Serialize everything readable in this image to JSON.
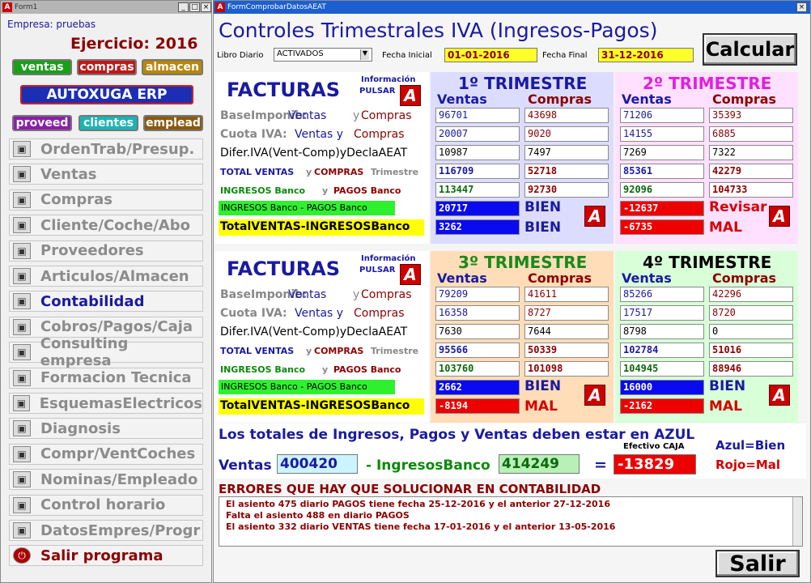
{
  "left_window": {
    "title": "Form1",
    "company": "Empresa: pruebas",
    "ejercicio": "Ejercicio: 2016",
    "tabs": [
      "ventas",
      "compras",
      "almacen"
    ],
    "banner": "AUTOXUGA ERP",
    "tabs2": [
      "proveed",
      "clientes",
      "emplead"
    ],
    "menu": [
      {
        "label": "OrdenTrab/Presup.",
        "icon": "tools-icon"
      },
      {
        "label": "Ventas",
        "icon": "sales-chart-icon"
      },
      {
        "label": "Compras",
        "icon": "purchases-icon"
      },
      {
        "label": "Cliente/Coche/Abo",
        "icon": "clients-icon"
      },
      {
        "label": "Proveedores",
        "icon": "suppliers-icon"
      },
      {
        "label": "Articulos/Almacen",
        "icon": "warehouse-icon"
      },
      {
        "label": "Contabilidad",
        "icon": "accounting-chart-icon"
      },
      {
        "label": "Cobros/Pagos/Caja",
        "icon": "cash-icon"
      },
      {
        "label": "Consulting empresa",
        "icon": "consulting-icon"
      },
      {
        "label": "Formacion Tecnica",
        "icon": "training-icon"
      },
      {
        "label": "EsquemasElectricos",
        "icon": "schematics-icon"
      },
      {
        "label": "Diagnosis",
        "icon": "diagnosis-icon"
      },
      {
        "label": "Compr/VentCoches",
        "icon": "car-icon"
      },
      {
        "label": "Nominas/Empleado",
        "icon": "employees-icon"
      },
      {
        "label": "Control horario",
        "icon": "clock-icon"
      },
      {
        "label": "DatosEmpres/Progr",
        "icon": "gear-icon"
      },
      {
        "label": "Salir programa",
        "icon": "exit-icon"
      }
    ]
  },
  "right_window": {
    "title": "FormComprobarDatosAEAT",
    "heading": "Controles Trimestrales IVA (Ingresos-Pagos)",
    "libro_label": "Libro Diario",
    "libro_value": "ACTIVADOS",
    "fecha_inicial_label": "Fecha Inicial",
    "fecha_inicial": "01-01-2016",
    "fecha_final_label": "Fecha Final",
    "fecha_final": "31-12-2016",
    "calcular": "Calcular",
    "facturas": "FACTURAS",
    "info": "Información",
    "pulsar": "PULSAR",
    "row_labels": {
      "base_a": "BaseImponib:",
      "base_b": "Ventas",
      "base_y": "y",
      "base_c": "Compras",
      "cuota_a": "Cuota IVA:",
      "cuota_b": "Ventas y",
      "cuota_c": "Compras",
      "difer": "Difer.IVA(Vent-Comp)yDeclaAEAT",
      "total_a": "TOTAL VENTAS",
      "total_y": "y",
      "total_b": "COMPRAS",
      "total_c": "Trimestre",
      "ing_a": "INGRESOS Banco",
      "ing_y": "y",
      "ing_b": "PAGOS Banco",
      "ingpag": "INGRESOS Banco - PAGOS Banco",
      "totalvi": "TotalVENTAS-INGRESOSBanco"
    },
    "ventas": "Ventas",
    "compras": "Compras",
    "trimestres": [
      {
        "title": "1º TRIMESTRE",
        "base": [
          "96701",
          "43698"
        ],
        "cuota": [
          "20007",
          "9020"
        ],
        "difer": [
          "10987",
          "7497"
        ],
        "total": [
          "116709",
          "52718"
        ],
        "banco": [
          "113447",
          "92730"
        ],
        "ip": "20717",
        "ip_status": "BIEN",
        "tv": "3262",
        "tv_status": "BIEN"
      },
      {
        "title": "2º TRIMESTRE",
        "base": [
          "71206",
          "35393"
        ],
        "cuota": [
          "14155",
          "6885"
        ],
        "difer": [
          "7269",
          "7322"
        ],
        "total": [
          "85361",
          "42279"
        ],
        "banco": [
          "92096",
          "104733"
        ],
        "ip": "-12637",
        "ip_status": "Revisar",
        "tv": "-6735",
        "tv_status": "MAL"
      },
      {
        "title": "3º TRIMESTRE",
        "base": [
          "79209",
          "41611"
        ],
        "cuota": [
          "16358",
          "8727"
        ],
        "difer": [
          "7630",
          "7644"
        ],
        "total": [
          "95566",
          "50339"
        ],
        "banco": [
          "103760",
          "101098"
        ],
        "ip": "2662",
        "ip_status": "BIEN",
        "tv": "-8194",
        "tv_status": "MAL"
      },
      {
        "title": "4º TRIMESTRE",
        "base": [
          "85266",
          "42296"
        ],
        "cuota": [
          "17517",
          "8720"
        ],
        "difer": [
          "8798",
          "0"
        ],
        "total": [
          "102784",
          "51016"
        ],
        "banco": [
          "104945",
          "88946"
        ],
        "ip": "16000",
        "ip_status": "BIEN",
        "tv": "-2162",
        "tv_status": "MAL"
      }
    ],
    "totales_msg": "Los totales de Ingresos, Pagos y Ventas deben estar en AZUL",
    "ventas_label": "Ventas",
    "ventas_total": "400420",
    "ingresos_label": "- IngresosBanco",
    "ingresos_total": "414249",
    "equals": "=",
    "efectivo_label": "Efectivo CAJA",
    "efectivo": "-13829",
    "azul": "Azul=Bien",
    "rojo": "Rojo=Mal",
    "errores_title": "ERRORES QUE HAY QUE SOLUCIONAR EN CONTABILIDAD",
    "errores": [
      "El asiento 475 diario PAGOS tiene fecha 25-12-2016 y el anterior 27-12-2016",
      "Falta el asiento 488 en diario PAGOS",
      "El asiento 332 diario VENTAS tiene fecha 17-01-2016 y el anterior 13-05-2016"
    ],
    "salir": "Salir"
  },
  "colors": {
    "blue": "#1a1aa0",
    "red": "#d40000",
    "green": "#00a000"
  }
}
